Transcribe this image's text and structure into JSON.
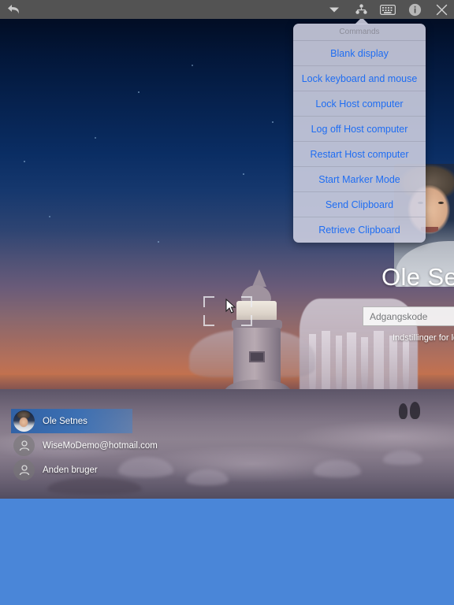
{
  "toolbar": {
    "back_icon": "back-arrow-icon",
    "icons": [
      {
        "name": "chevron-down-icon",
        "label": "Commands menu"
      },
      {
        "name": "connections-icon",
        "label": "Connections"
      },
      {
        "name": "keyboard-icon",
        "label": "Keyboard"
      },
      {
        "name": "info-icon",
        "label": "Info"
      },
      {
        "name": "close-icon",
        "label": "Close"
      }
    ]
  },
  "popover": {
    "header": "Commands",
    "items": [
      {
        "label": "Blank display"
      },
      {
        "label": "Lock keyboard and mouse"
      },
      {
        "label": "Lock Host computer"
      },
      {
        "label": "Log off Host computer"
      },
      {
        "label": "Restart Host computer"
      },
      {
        "label": "Start Marker Mode"
      },
      {
        "label": "Send Clipboard"
      },
      {
        "label": "Retrieve Clipboard"
      }
    ],
    "accent_color": "#1f6df2",
    "background_color": "#d0d2e2",
    "header_color": "#8b8c99"
  },
  "lockscreen": {
    "display_name": "Ole Setnes",
    "password_placeholder": "Adgangskode",
    "password_value": "",
    "logon_options": "Indstillinger for logon",
    "users": [
      {
        "name": "Ole Setnes",
        "avatar": "photo-avatar",
        "selected": true
      },
      {
        "name": "WiseMoDemo@hotmail.com",
        "avatar": "person-icon",
        "selected": false
      },
      {
        "name": "Anden bruger",
        "avatar": "person-icon",
        "selected": false
      }
    ],
    "selection_color": "#2a60a8"
  },
  "viewport": {
    "marker_brackets": "marker-selection-brackets",
    "cursor": "mouse-cursor",
    "filler_color": "#4a86d8",
    "toolbar_color": "#535353"
  }
}
